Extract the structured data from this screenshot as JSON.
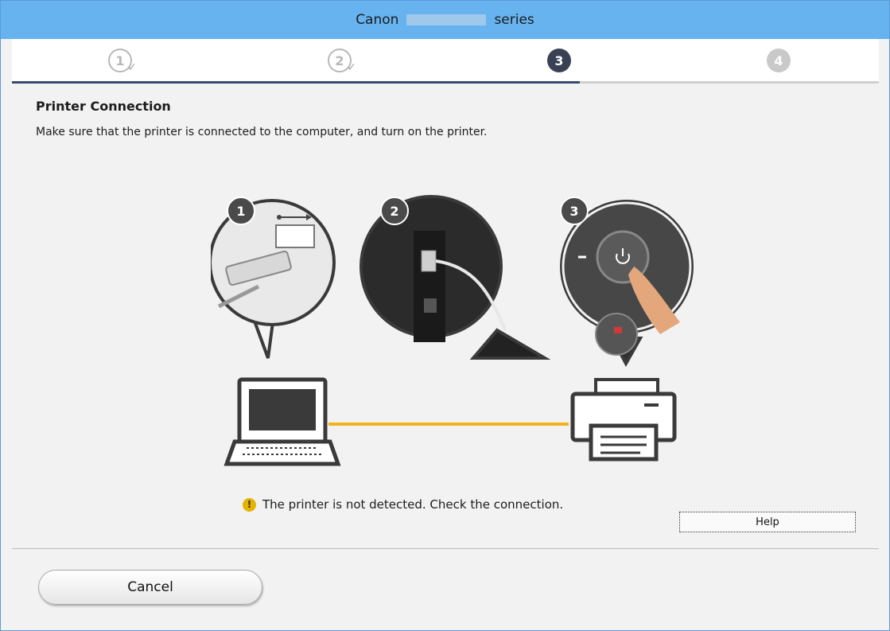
{
  "window": {
    "title_prefix": "Canon",
    "title_suffix": "series"
  },
  "steps": [
    "1",
    "2",
    "3",
    "4"
  ],
  "progress": {
    "current_step": 3,
    "total_steps": 4
  },
  "page": {
    "heading": "Printer Connection",
    "instruction": "Make sure that the printer is connected to the computer, and turn on the printer."
  },
  "illustration": {
    "badges": [
      "1",
      "2",
      "3"
    ],
    "icons": [
      "usb-icon",
      "power-icon",
      "laptop-icon",
      "printer-icon"
    ],
    "cable_color": "#f2b21c"
  },
  "status": {
    "icon_glyph": "!",
    "message": "The printer is not detected. Check the connection."
  },
  "buttons": {
    "help": "Help",
    "cancel": "Cancel"
  },
  "colors": {
    "titlebar": "#66b3f0",
    "step_current": "#3a4154",
    "warning": "#e5b400"
  }
}
